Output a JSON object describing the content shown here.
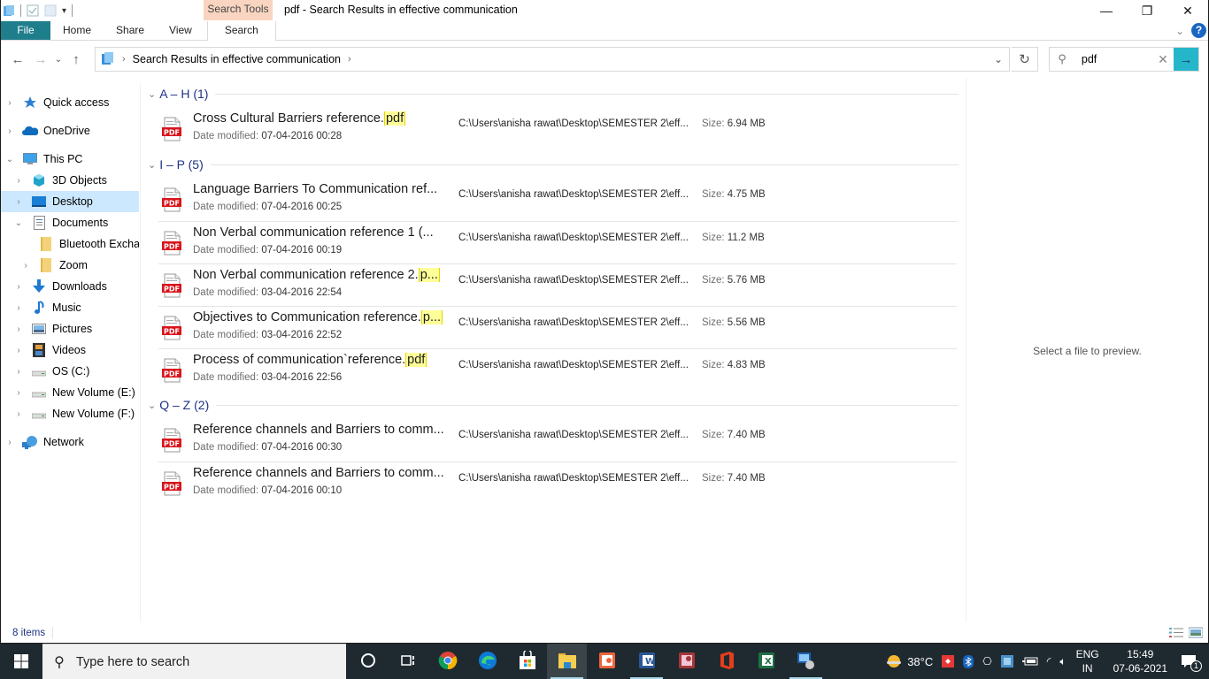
{
  "window": {
    "title": "pdf - Search Results in effective communication",
    "context_tab_group": "Search Tools",
    "controls": {
      "minimize": "—",
      "maximize": "❐",
      "close": "✕"
    }
  },
  "ribbon": {
    "tabs": [
      {
        "label": "File",
        "id": "file"
      },
      {
        "label": "Home",
        "id": "home"
      },
      {
        "label": "Share",
        "id": "share"
      },
      {
        "label": "View",
        "id": "view"
      },
      {
        "label": "Search",
        "id": "search"
      }
    ],
    "collapse_glyph": "⌄",
    "help_glyph": "?"
  },
  "nav": {
    "back": "←",
    "forward": "→",
    "recent": "⌄",
    "up": "↑",
    "breadcrumb": [
      "Search Results in effective communication"
    ],
    "refresh": "↻",
    "search": {
      "value": "pdf",
      "placeholder": "Search",
      "clear": "✕",
      "go": "→"
    }
  },
  "sidebar": {
    "items": [
      {
        "label": "Quick access",
        "icon": "star-icon",
        "chevron": "›",
        "indent": 0
      },
      {
        "label": "OneDrive",
        "icon": "cloud-icon",
        "chevron": "›",
        "indent": 0
      },
      {
        "label": "This PC",
        "icon": "computer-icon",
        "chevron": "⌄",
        "indent": 0
      },
      {
        "label": "3D Objects",
        "icon": "cube-icon",
        "chevron": "›",
        "indent": 1
      },
      {
        "label": "Desktop",
        "icon": "desktop-icon",
        "chevron": "›",
        "indent": 1,
        "selected": true
      },
      {
        "label": "Documents",
        "icon": "document-icon",
        "chevron": "⌄",
        "indent": 1
      },
      {
        "label": "Bluetooth Exchange Folder",
        "icon": "folder-icon",
        "chevron": "",
        "indent": 2
      },
      {
        "label": "Zoom",
        "icon": "folder-icon",
        "chevron": "›",
        "indent": 2
      },
      {
        "label": "Downloads",
        "icon": "download-icon",
        "chevron": "›",
        "indent": 1
      },
      {
        "label": "Music",
        "icon": "music-icon",
        "chevron": "›",
        "indent": 1
      },
      {
        "label": "Pictures",
        "icon": "pictures-icon",
        "chevron": "›",
        "indent": 1
      },
      {
        "label": "Videos",
        "icon": "video-icon",
        "chevron": "›",
        "indent": 1
      },
      {
        "label": "OS (C:)",
        "icon": "drive-icon",
        "chevron": "›",
        "indent": 1
      },
      {
        "label": "New Volume (E:)",
        "icon": "drive-icon",
        "chevron": "›",
        "indent": 1
      },
      {
        "label": "New Volume (F:)",
        "icon": "drive-icon",
        "chevron": "›",
        "indent": 1
      },
      {
        "label": "Network",
        "icon": "network-icon",
        "chevron": "›",
        "indent": 0
      }
    ]
  },
  "results": {
    "date_label": "Date modified:",
    "size_label": "Size:",
    "groups": [
      {
        "label": "A – H (1)",
        "files": [
          {
            "name": "Cross Cultural Barriers reference.",
            "match": "pdf",
            "date": "07-04-2016 00:28",
            "path": "C:\\Users\\anisha rawat\\Desktop\\SEMESTER 2\\eff...",
            "size": "6.94 MB"
          }
        ]
      },
      {
        "label": "I – P (5)",
        "files": [
          {
            "name": "Language Barriers To Communication ref...",
            "match": "",
            "date": "07-04-2016 00:25",
            "path": "C:\\Users\\anisha rawat\\Desktop\\SEMESTER 2\\eff...",
            "size": "4.75 MB"
          },
          {
            "name": "Non Verbal communication reference  1 (...",
            "match": "",
            "date": "07-04-2016 00:19",
            "path": "C:\\Users\\anisha rawat\\Desktop\\SEMESTER 2\\eff...",
            "size": "11.2 MB"
          },
          {
            "name": "Non Verbal communication reference  2.",
            "match": "p...",
            "date": "03-04-2016 22:54",
            "path": "C:\\Users\\anisha rawat\\Desktop\\SEMESTER 2\\eff...",
            "size": "5.76 MB"
          },
          {
            "name": "Objectives to Communication reference.",
            "match": "p...",
            "date": "03-04-2016 22:52",
            "path": "C:\\Users\\anisha rawat\\Desktop\\SEMESTER 2\\eff...",
            "size": "5.56 MB"
          },
          {
            "name": "Process of communication`reference.",
            "match": "pdf",
            "date": "03-04-2016 22:56",
            "path": "C:\\Users\\anisha rawat\\Desktop\\SEMESTER 2\\eff...",
            "size": "4.83 MB"
          }
        ]
      },
      {
        "label": "Q – Z (2)",
        "files": [
          {
            "name": "Reference channels and Barriers to comm...",
            "match": "",
            "date": "07-04-2016 00:30",
            "path": "C:\\Users\\anisha rawat\\Desktop\\SEMESTER 2\\eff...",
            "size": "7.40 MB"
          },
          {
            "name": "Reference channels and Barriers to comm...",
            "match": "",
            "date": "07-04-2016 00:10",
            "path": "C:\\Users\\anisha rawat\\Desktop\\SEMESTER 2\\eff...",
            "size": "7.40 MB"
          }
        ]
      }
    ]
  },
  "preview": {
    "message": "Select a file to preview."
  },
  "status": {
    "item_count": "8 items"
  },
  "taskbar": {
    "search_placeholder": "Type here to search",
    "apps": [
      {
        "name": "cortana",
        "active": false,
        "running": false
      },
      {
        "name": "task-view",
        "active": false,
        "running": false
      },
      {
        "name": "chrome",
        "active": false,
        "running": false
      },
      {
        "name": "edge",
        "active": false,
        "running": false
      },
      {
        "name": "store",
        "active": false,
        "running": false
      },
      {
        "name": "file-explorer",
        "active": true,
        "running": true
      },
      {
        "name": "powerpoint",
        "active": false,
        "running": false
      },
      {
        "name": "word",
        "active": false,
        "running": true
      },
      {
        "name": "access",
        "active": false,
        "running": false
      },
      {
        "name": "office",
        "active": false,
        "running": false
      },
      {
        "name": "excel",
        "active": false,
        "running": false
      },
      {
        "name": "remote-desktop",
        "active": false,
        "running": true
      }
    ],
    "weather": "38°C",
    "language": {
      "top": "ENG",
      "bottom": "IN"
    },
    "clock": {
      "time": "15:49",
      "date": "07-06-2021"
    },
    "notifications": "1"
  }
}
